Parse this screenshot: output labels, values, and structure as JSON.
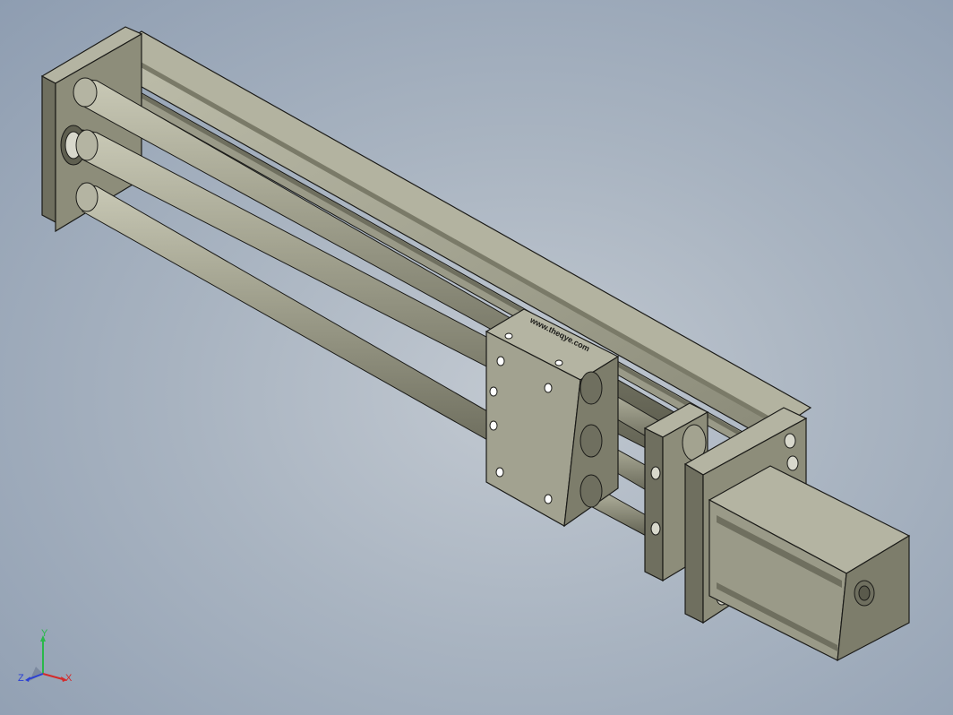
{
  "viewport": {
    "background_top": "#8e9db1",
    "background_center": "#c2c9d1"
  },
  "model": {
    "engraved_text": "www.theqye.com",
    "part_color": "#8d8d7a",
    "part_shadow": "#6f6f5f",
    "part_highlight": "#b4b4a2",
    "edge_color": "#1b1b18"
  },
  "triad": {
    "x_label": "X",
    "y_label": "Y",
    "z_label": "Z",
    "x_color": "#d42a2a",
    "y_color": "#2ab84a",
    "z_color": "#2a3fd4"
  }
}
